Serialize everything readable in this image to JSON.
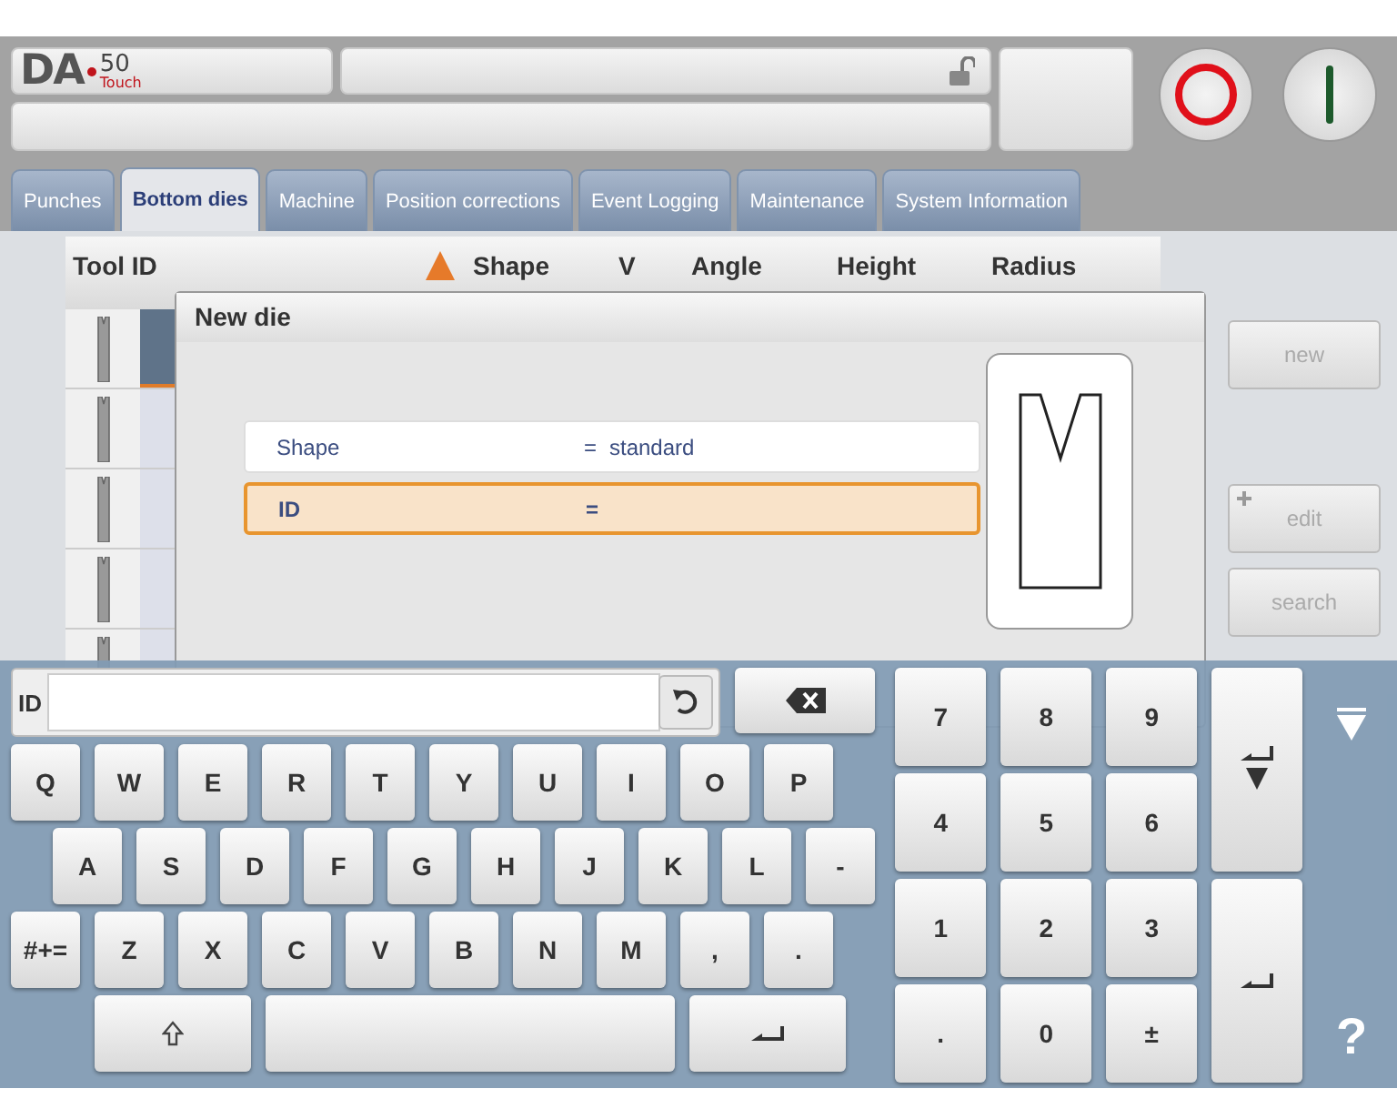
{
  "header": {
    "logo": {
      "brand": "DA",
      "model": "50",
      "edition": "Touch"
    },
    "locked": false
  },
  "tabs": [
    {
      "label": "Punches",
      "selected": false
    },
    {
      "label": "Bottom dies",
      "selected": true
    },
    {
      "label": "Machine",
      "selected": false
    },
    {
      "label": "Position corrections",
      "selected": false
    },
    {
      "label": "Event Logging",
      "selected": false
    },
    {
      "label": "Maintenance",
      "selected": false
    },
    {
      "label": "System Information",
      "selected": false
    }
  ],
  "table": {
    "columns": [
      "Tool ID",
      "Shape",
      "V",
      "Angle",
      "Height",
      "Radius"
    ],
    "rows": [
      {
        "selected": true
      },
      {
        "selected": false
      },
      {
        "selected": false
      },
      {
        "selected": false
      },
      {
        "selected": false
      }
    ]
  },
  "side_buttons": [
    {
      "label": "new",
      "kind": "plain",
      "disabled": true
    },
    {
      "label": "edit",
      "kind": "plus",
      "disabled": true
    },
    {
      "label": "search",
      "kind": "plain",
      "disabled": true
    }
  ],
  "dialog": {
    "title": "New die",
    "fields": [
      {
        "label": "Shape",
        "separator": "=",
        "value": "standard",
        "selected": false
      },
      {
        "label": "ID",
        "separator": "=",
        "selected": true
      }
    ]
  },
  "keyboard": {
    "field_label": "ID",
    "letter_rows": [
      [
        "Q",
        "W",
        "E",
        "R",
        "T",
        "Y",
        "U",
        "I",
        "O",
        "P"
      ],
      [
        "A",
        "S",
        "D",
        "F",
        "G",
        "H",
        "J",
        "K",
        "L",
        "-"
      ],
      [
        "#+=",
        "Z",
        "X",
        "C",
        "V",
        "B",
        "N",
        "M",
        ",",
        "."
      ]
    ],
    "numpad": [
      [
        "7",
        "8",
        "9"
      ],
      [
        "4",
        "5",
        "6"
      ],
      [
        "1",
        "2",
        "3"
      ],
      [
        ".",
        "0",
        "±"
      ]
    ],
    "help": "?"
  }
}
